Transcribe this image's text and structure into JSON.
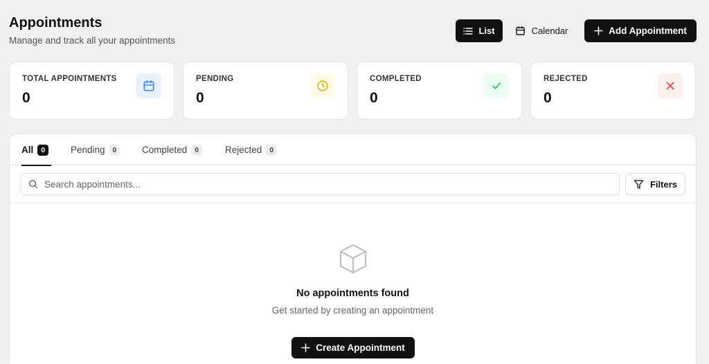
{
  "header": {
    "title": "Appointments",
    "subtitle": "Manage and track all your appointments"
  },
  "view_toggle": {
    "list_label": "List",
    "calendar_label": "Calendar",
    "selected": "List"
  },
  "add_button": {
    "label": "Add Appointment"
  },
  "stats": [
    {
      "label": "TOTAL APPOINTMENTS",
      "value": "0",
      "icon": "calendar-icon",
      "icon_color": "#3b82f6",
      "icon_bg": "#e8f1fe"
    },
    {
      "label": "PENDING",
      "value": "0",
      "icon": "clock-icon",
      "icon_color": "#eab308",
      "icon_bg": "#fefbe8"
    },
    {
      "label": "COMPLETED",
      "value": "0",
      "icon": "check-icon",
      "icon_color": "#22c55e",
      "icon_bg": "#ecfdf3"
    },
    {
      "label": "REJECTED",
      "value": "0",
      "icon": "x-icon",
      "icon_color": "#ef4444",
      "icon_bg": "#fdf0f0"
    }
  ],
  "tabs": [
    {
      "label": "All",
      "count": "0",
      "active": true
    },
    {
      "label": "Pending",
      "count": "0",
      "active": false
    },
    {
      "label": "Completed",
      "count": "0",
      "active": false
    },
    {
      "label": "Rejected",
      "count": "0",
      "active": false
    }
  ],
  "search": {
    "placeholder": "Search appointments..."
  },
  "filters": {
    "label": "Filters"
  },
  "empty_state": {
    "icon": "box-icon",
    "title": "No appointments found",
    "subtitle": "Get started by creating an appointment",
    "button_label": "Create Appointment"
  }
}
